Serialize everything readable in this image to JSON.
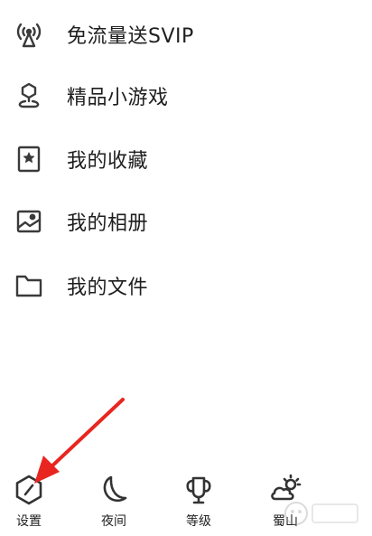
{
  "menu": {
    "items": [
      {
        "label": "免流量送SVIP",
        "icon": "antenna-icon"
      },
      {
        "label": "精品小游戏",
        "icon": "game-location-icon"
      },
      {
        "label": "我的收藏",
        "icon": "bookmark-star-icon"
      },
      {
        "label": "我的相册",
        "icon": "photo-album-icon"
      },
      {
        "label": "我的文件",
        "icon": "folder-icon"
      }
    ]
  },
  "bottom_bar": {
    "items": [
      {
        "label": "设置",
        "icon": "settings-hexagon-icon"
      },
      {
        "label": "夜间",
        "icon": "moon-icon"
      },
      {
        "label": "等级",
        "icon": "level-badge-icon"
      },
      {
        "label": "蜀山",
        "icon": "cloud-sun-icon"
      }
    ]
  },
  "colors": {
    "icon_stroke": "#3a3a3a",
    "text": "#1e1e1e",
    "annotation_arrow": "#e8261f"
  }
}
